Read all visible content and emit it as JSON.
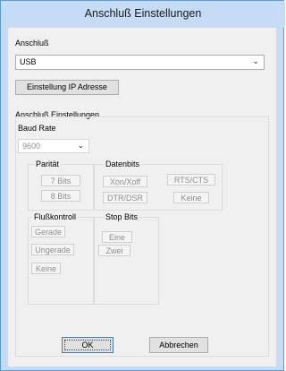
{
  "window": {
    "title": "Anschluß Einstellungen"
  },
  "anschluss": {
    "label": "Anschluß",
    "selected": "USB"
  },
  "ip_button": "Einstellung IP Adresse",
  "settings_group": {
    "title": "Anschluß Einstellungen"
  },
  "baud": {
    "label": "Baud Rate",
    "selected": "9600"
  },
  "paritaet": {
    "title": "Parität",
    "buttons": [
      "7 Bits",
      "8 Bits"
    ]
  },
  "datenbits": {
    "title": "Datenbits",
    "buttons": [
      "Xon/Xoff",
      "RTS/CTS",
      "DTR/DSR",
      "Keine"
    ]
  },
  "flusskontroll": {
    "title": "Flußkontroll",
    "buttons": [
      "Gerade",
      "Ungerade",
      "Keine"
    ]
  },
  "stopbits": {
    "title": "Stop Bits",
    "buttons": [
      "Eine",
      "Zwei"
    ]
  },
  "footer": {
    "ok": "OK",
    "cancel": "Abbrechen"
  }
}
